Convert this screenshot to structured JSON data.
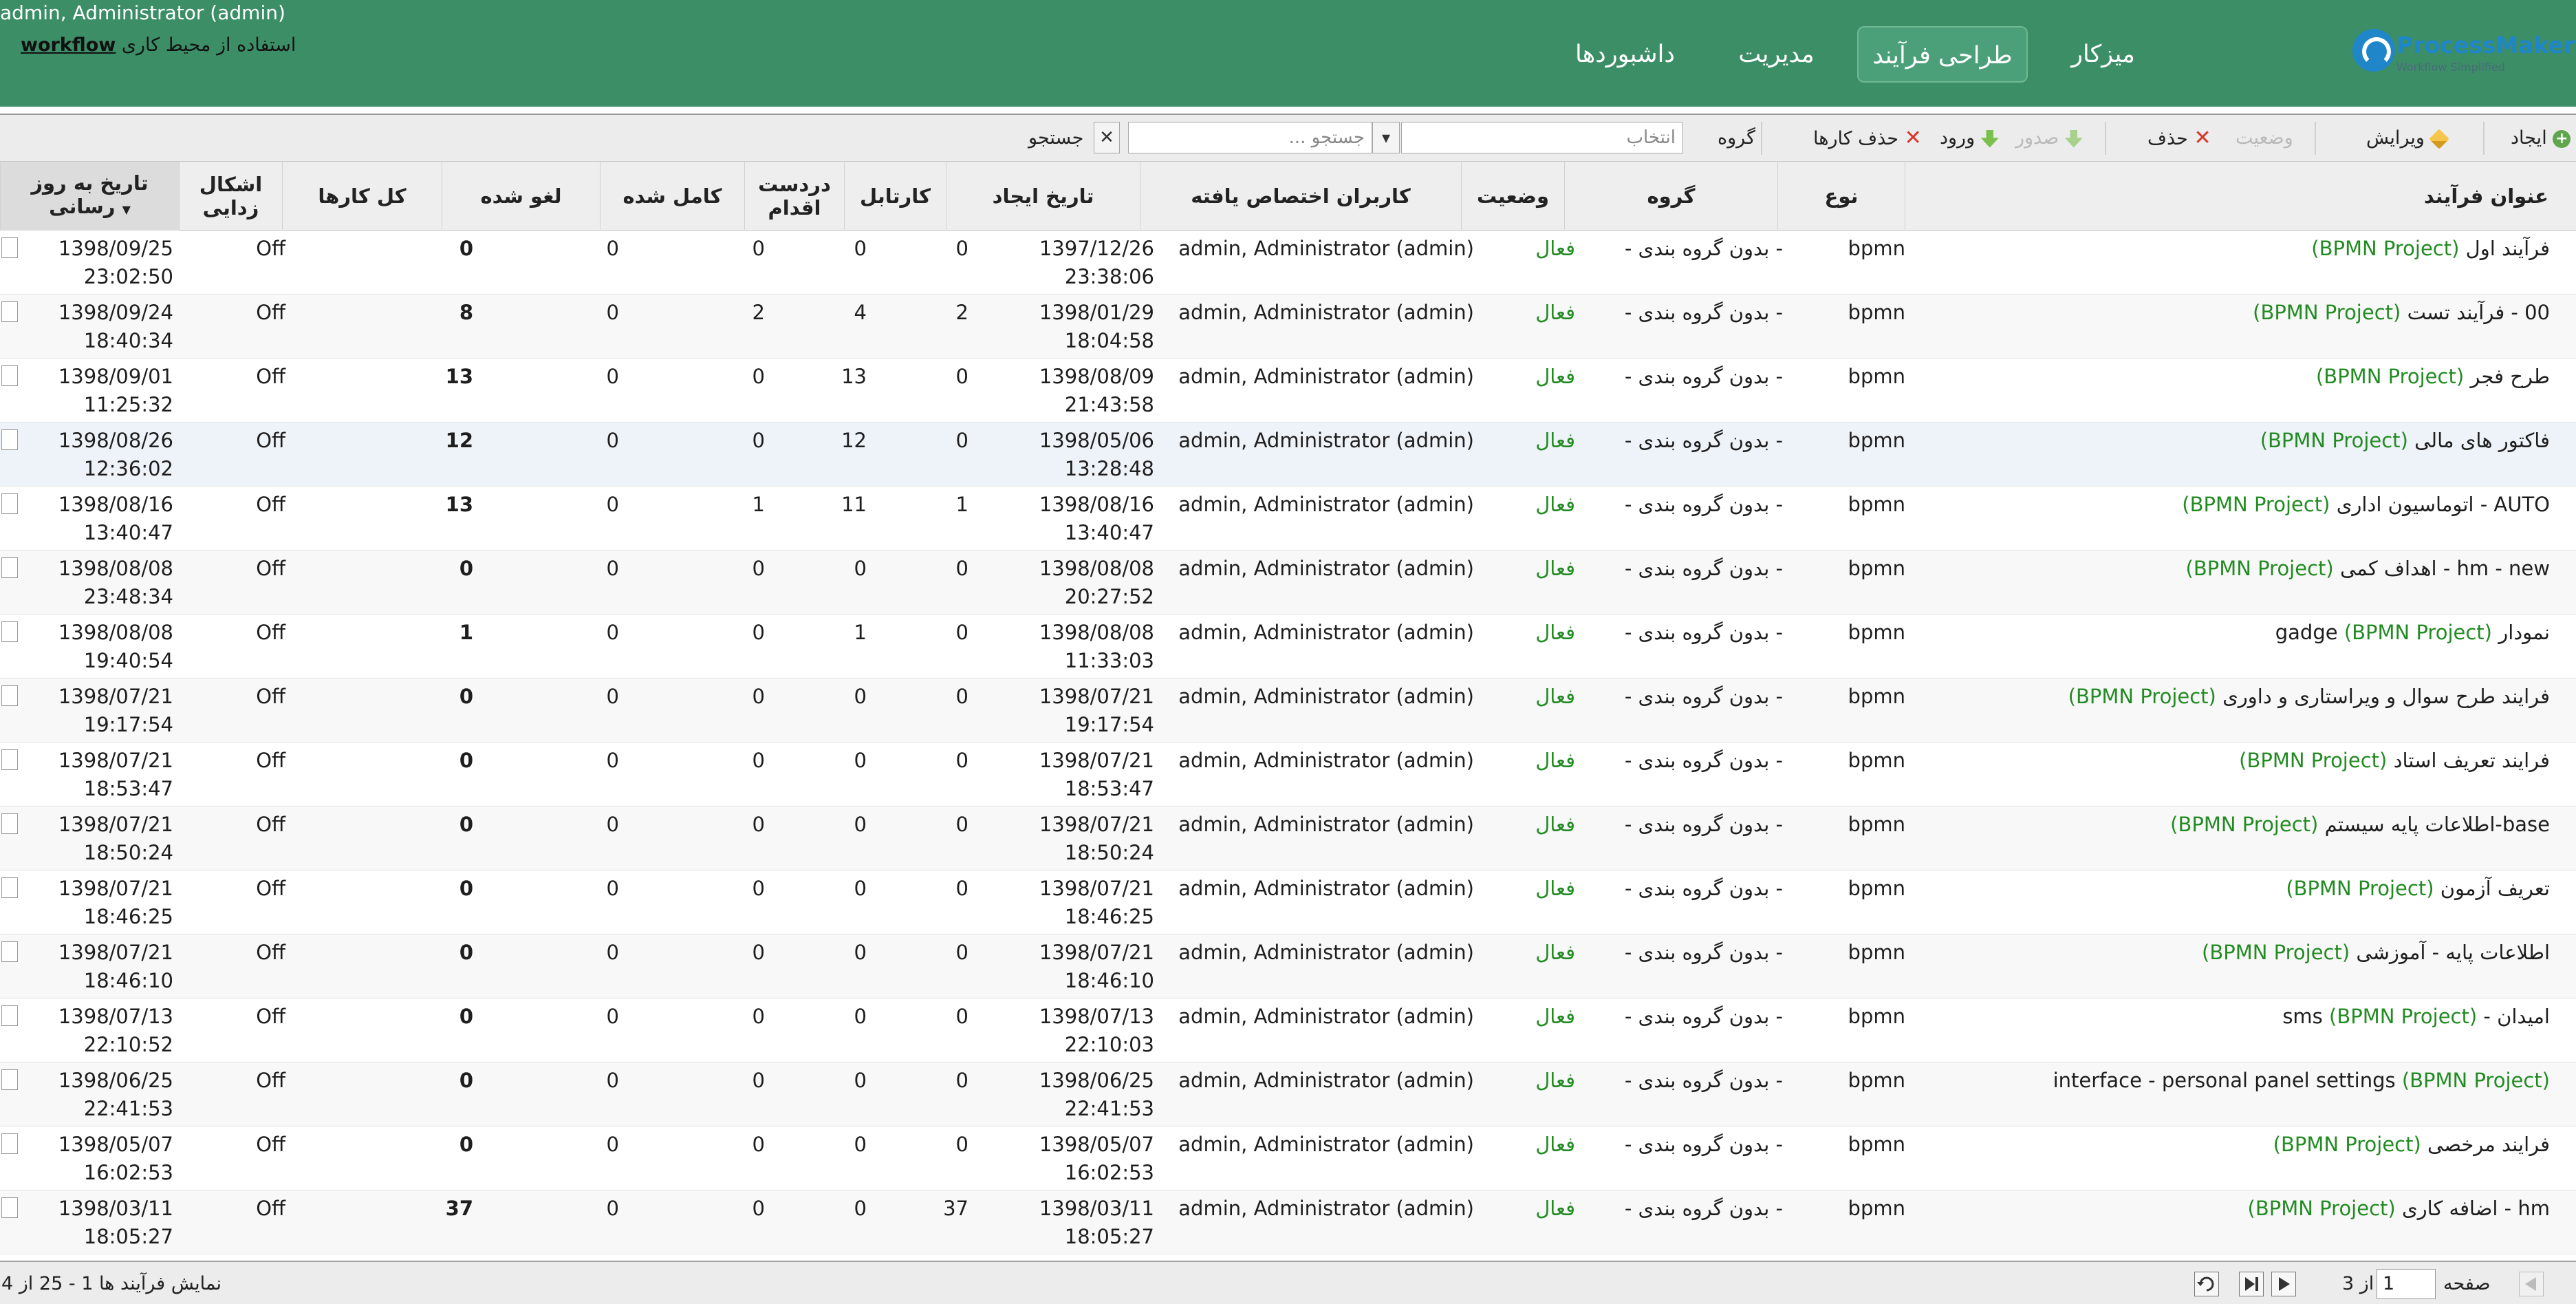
{
  "header": {
    "user": "admin, Administrator (admin)",
    "workspace_label": "استفاده از محیط کاری",
    "workspace_name": "workflow",
    "logo_name": "ProcessMaker",
    "logo_tagline": "Workflow Simplified",
    "nav": [
      {
        "label": "میزکار"
      },
      {
        "label": "طراحی فرآیند",
        "active": true
      },
      {
        "label": "مدیریت"
      },
      {
        "label": "داشبوردها"
      }
    ],
    "colors": {
      "header": "#3c8e67",
      "active_tab": "#4ba07a",
      "status_active": "#228b22",
      "logo": "#1f86c9"
    }
  },
  "toolbar": {
    "create": "ایجاد",
    "edit": "ویرایش",
    "status": "وضعیت",
    "delete": "حذف",
    "export": "صدور",
    "import": "ورود",
    "delete_cases": "حذف کارها",
    "group_label": "گروه",
    "group_placeholder": "انتخاب",
    "search_placeholder": "جستجو ...",
    "search_button": "جستجو"
  },
  "grid": {
    "columns": {
      "title": "عنوان فرآیند",
      "type": "نوع",
      "category": "گروه",
      "status": "وضعیت",
      "users": "کاربران اختصاص یافته",
      "created": "تاریخ ایجاد",
      "cartable": "کارتابل",
      "in_progress": "دردست اقدام",
      "completed": "کامل شده",
      "cancelled": "لغو شده",
      "total": "کل کارها",
      "debug": "اشکال زدایی",
      "updated": "تاریخ به روز رسانی"
    },
    "rows": [
      {
        "name": "فرآیند اول",
        "ptype": "(BPMN Project)",
        "type": "bpmn",
        "category": "- بدون گروه بندی -",
        "status": "فعال",
        "user": "admin, Administrator (admin)",
        "created_date": "1397/12/26",
        "created_time": "23:38:06",
        "c_cartable": "0",
        "c_progress": "0",
        "c_completed": "0",
        "c_cancelled": "0",
        "c_total": "0",
        "debug": "Off",
        "updated_date": "1398/09/25",
        "updated_time": "23:02:50"
      },
      {
        "name": "00 - فرآیند تست",
        "ptype": "(BPMN Project)",
        "type": "bpmn",
        "category": "- بدون گروه بندی -",
        "status": "فعال",
        "user": "admin, Administrator (admin)",
        "created_date": "1398/01/29",
        "created_time": "18:04:58",
        "c_cartable": "2",
        "c_progress": "4",
        "c_completed": "2",
        "c_cancelled": "0",
        "c_total": "8",
        "debug": "Off",
        "updated_date": "1398/09/24",
        "updated_time": "18:40:34"
      },
      {
        "name": "طرح فجر",
        "ptype": "(BPMN Project)",
        "type": "bpmn",
        "category": "- بدون گروه بندی -",
        "status": "فعال",
        "user": "admin, Administrator (admin)",
        "created_date": "1398/08/09",
        "created_time": "21:43:58",
        "c_cartable": "0",
        "c_progress": "13",
        "c_completed": "0",
        "c_cancelled": "0",
        "c_total": "13",
        "debug": "Off",
        "updated_date": "1398/09/01",
        "updated_time": "11:25:32"
      },
      {
        "name": "فاکتور های مالی",
        "ptype": "(BPMN Project)",
        "type": "bpmn",
        "category": "- بدون گروه بندی -",
        "status": "فعال",
        "user": "admin, Administrator (admin)",
        "created_date": "1398/05/06",
        "created_time": "13:28:48",
        "c_cartable": "0",
        "c_progress": "12",
        "c_completed": "0",
        "c_cancelled": "0",
        "c_total": "12",
        "debug": "Off",
        "updated_date": "1398/08/26",
        "updated_time": "12:36:02"
      },
      {
        "name": "AUTO - اتوماسیون اداری",
        "ptype": "(BPMN Project)",
        "type": "bpmn",
        "category": "- بدون گروه بندی -",
        "status": "فعال",
        "user": "admin, Administrator (admin)",
        "created_date": "1398/08/16",
        "created_time": "13:40:47",
        "c_cartable": "1",
        "c_progress": "11",
        "c_completed": "1",
        "c_cancelled": "0",
        "c_total": "13",
        "debug": "Off",
        "updated_date": "1398/08/16",
        "updated_time": "13:40:47"
      },
      {
        "name": "hm - new - اهداف کمی",
        "ptype": "(BPMN Project)",
        "type": "bpmn",
        "category": "- بدون گروه بندی -",
        "status": "فعال",
        "user": "admin, Administrator (admin)",
        "created_date": "1398/08/08",
        "created_time": "20:27:52",
        "c_cartable": "0",
        "c_progress": "0",
        "c_completed": "0",
        "c_cancelled": "0",
        "c_total": "0",
        "debug": "Off",
        "updated_date": "1398/08/08",
        "updated_time": "23:48:34"
      },
      {
        "name": "نمودار gadge",
        "ptype": "(BPMN Project)",
        "type": "bpmn",
        "category": "- بدون گروه بندی -",
        "status": "فعال",
        "user": "admin, Administrator (admin)",
        "created_date": "1398/08/08",
        "created_time": "11:33:03",
        "c_cartable": "0",
        "c_progress": "1",
        "c_completed": "0",
        "c_cancelled": "0",
        "c_total": "1",
        "debug": "Off",
        "updated_date": "1398/08/08",
        "updated_time": "19:40:54"
      },
      {
        "name": "فرایند طرح سوال و ویراستاری و داوری",
        "ptype": "(BPMN Project)",
        "type": "bpmn",
        "category": "- بدون گروه بندی -",
        "status": "فعال",
        "user": "admin, Administrator (admin)",
        "created_date": "1398/07/21",
        "created_time": "19:17:54",
        "c_cartable": "0",
        "c_progress": "0",
        "c_completed": "0",
        "c_cancelled": "0",
        "c_total": "0",
        "debug": "Off",
        "updated_date": "1398/07/21",
        "updated_time": "19:17:54"
      },
      {
        "name": "فرایند تعریف استاد",
        "ptype": "(BPMN Project)",
        "type": "bpmn",
        "category": "- بدون گروه بندی -",
        "status": "فعال",
        "user": "admin, Administrator (admin)",
        "created_date": "1398/07/21",
        "created_time": "18:53:47",
        "c_cartable": "0",
        "c_progress": "0",
        "c_completed": "0",
        "c_cancelled": "0",
        "c_total": "0",
        "debug": "Off",
        "updated_date": "1398/07/21",
        "updated_time": "18:53:47"
      },
      {
        "name": "base-اطلاعات پایه سیستم",
        "ptype": "(BPMN Project)",
        "type": "bpmn",
        "category": "- بدون گروه بندی -",
        "status": "فعال",
        "user": "admin, Administrator (admin)",
        "created_date": "1398/07/21",
        "created_time": "18:50:24",
        "c_cartable": "0",
        "c_progress": "0",
        "c_completed": "0",
        "c_cancelled": "0",
        "c_total": "0",
        "debug": "Off",
        "updated_date": "1398/07/21",
        "updated_time": "18:50:24"
      },
      {
        "name": "تعریف آزمون",
        "ptype": "(BPMN Project)",
        "type": "bpmn",
        "category": "- بدون گروه بندی -",
        "status": "فعال",
        "user": "admin, Administrator (admin)",
        "created_date": "1398/07/21",
        "created_time": "18:46:25",
        "c_cartable": "0",
        "c_progress": "0",
        "c_completed": "0",
        "c_cancelled": "0",
        "c_total": "0",
        "debug": "Off",
        "updated_date": "1398/07/21",
        "updated_time": "18:46:25"
      },
      {
        "name": "اطلاعات پایه - آموزشی",
        "ptype": "(BPMN Project)",
        "type": "bpmn",
        "category": "- بدون گروه بندی -",
        "status": "فعال",
        "user": "admin, Administrator (admin)",
        "created_date": "1398/07/21",
        "created_time": "18:46:10",
        "c_cartable": "0",
        "c_progress": "0",
        "c_completed": "0",
        "c_cancelled": "0",
        "c_total": "0",
        "debug": "Off",
        "updated_date": "1398/07/21",
        "updated_time": "18:46:10"
      },
      {
        "name": "امیدان - sms",
        "ptype": "(BPMN Project)",
        "type": "bpmn",
        "category": "- بدون گروه بندی -",
        "status": "فعال",
        "user": "admin, Administrator (admin)",
        "created_date": "1398/07/13",
        "created_time": "22:10:03",
        "c_cartable": "0",
        "c_progress": "0",
        "c_completed": "0",
        "c_cancelled": "0",
        "c_total": "0",
        "debug": "Off",
        "updated_date": "1398/07/13",
        "updated_time": "22:10:52"
      },
      {
        "name": "interface - personal panel settings",
        "ptype": "(BPMN Project)",
        "type": "bpmn",
        "category": "- بدون گروه بندی -",
        "status": "فعال",
        "user": "admin, Administrator (admin)",
        "created_date": "1398/06/25",
        "created_time": "22:41:53",
        "c_cartable": "0",
        "c_progress": "0",
        "c_completed": "0",
        "c_cancelled": "0",
        "c_total": "0",
        "debug": "Off",
        "updated_date": "1398/06/25",
        "updated_time": "22:41:53"
      },
      {
        "name": "فرایند مرخصی",
        "ptype": "(BPMN Project)",
        "type": "bpmn",
        "category": "- بدون گروه بندی -",
        "status": "فعال",
        "user": "admin, Administrator (admin)",
        "created_date": "1398/05/07",
        "created_time": "16:02:53",
        "c_cartable": "0",
        "c_progress": "0",
        "c_completed": "0",
        "c_cancelled": "0",
        "c_total": "0",
        "debug": "Off",
        "updated_date": "1398/05/07",
        "updated_time": "16:02:53"
      },
      {
        "name": "hm - اضافه کاری",
        "ptype": "(BPMN Project)",
        "type": "bpmn",
        "category": "- بدون گروه بندی -",
        "status": "فعال",
        "user": "admin, Administrator (admin)",
        "created_date": "1398/03/11",
        "created_time": "18:05:27",
        "c_cartable": "37",
        "c_progress": "0",
        "c_completed": "0",
        "c_cancelled": "0",
        "c_total": "37",
        "debug": "Off",
        "updated_date": "1398/03/11",
        "updated_time": "18:05:27"
      }
    ]
  },
  "footer": {
    "page_label": "صفحه",
    "page_value": "1",
    "page_of": "از 3",
    "display_info": "نمایش فرآیند ها 1 - 25 از 4"
  }
}
